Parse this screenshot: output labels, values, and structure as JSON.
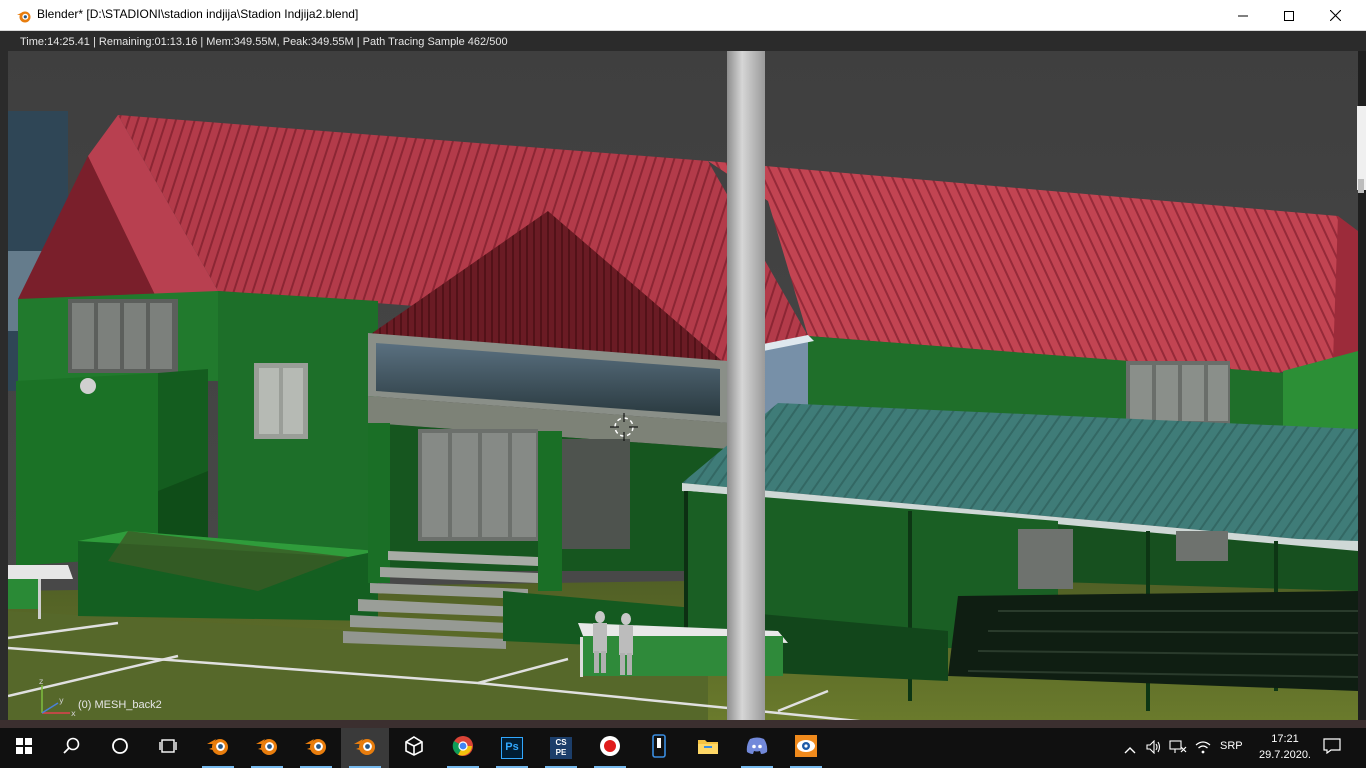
{
  "window": {
    "title": "Blender* [D:\\STADIONI\\stadion indjija\\Stadion Indjija2.blend]",
    "icon": "blender-icon",
    "controls": [
      "minimize-icon",
      "maximize-icon",
      "close-icon"
    ]
  },
  "viewport": {
    "render_stats": "Time:14:25.41 | Remaining:01:13.16 | Mem:349.55M, Peak:349.55M | Path Tracing Sample 462/500",
    "active_object": "(0) MESH_back2",
    "axis_labels": {
      "x": "x",
      "y": "y",
      "z": "z"
    }
  },
  "taskbar": {
    "apps": [
      {
        "icon": "windows-start-icon"
      },
      {
        "icon": "search-icon"
      },
      {
        "icon": "cortana-icon"
      },
      {
        "icon": "task-view-icon"
      },
      {
        "icon": "blender-icon"
      },
      {
        "icon": "blender-icon"
      },
      {
        "icon": "blender-icon"
      },
      {
        "icon": "blender-icon",
        "active": true
      },
      {
        "icon": "unity-icon"
      },
      {
        "icon": "chrome-icon"
      },
      {
        "icon": "photoshop-icon",
        "label": "Ps"
      },
      {
        "icon": "cspe-icon",
        "label": "CS PE"
      },
      {
        "icon": "record-icon"
      },
      {
        "icon": "zipper-icon"
      },
      {
        "icon": "folder-icon"
      },
      {
        "icon": "discord-icon"
      },
      {
        "icon": "blender-orange-icon"
      }
    ],
    "tray": {
      "language": "SRP",
      "time": "17:21",
      "date": "29.7.2020."
    }
  }
}
